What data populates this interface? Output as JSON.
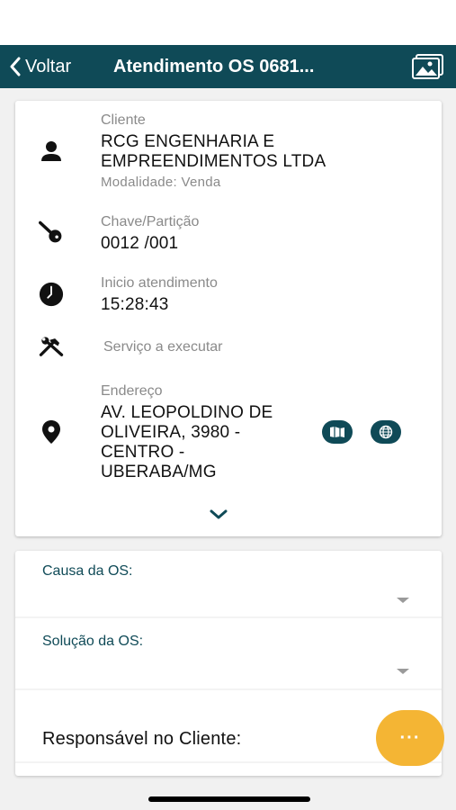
{
  "header": {
    "back_label": "Voltar",
    "title": "Atendimento OS 0681...",
    "gallery_icon": "gallery-icon",
    "bar_color": "#0f4a57"
  },
  "details": {
    "cliente": {
      "label": "Cliente",
      "name_line1": "RCG ENGENHARIA E",
      "name_line2": "EMPREENDIMENTOS LTDA",
      "modalidade": "Modalidade: Venda",
      "icon": "person-icon"
    },
    "chave": {
      "label": "Chave/Partição",
      "value": "0012 /001",
      "icon": "key-icon"
    },
    "inicio": {
      "label": "Inicio atendimento",
      "value": "15:28:43",
      "icon": "clock-icon"
    },
    "servico": {
      "label": "Serviço a executar",
      "icon": "tools-icon"
    },
    "endereco": {
      "label": "Endereço",
      "line1": "AV. LEOPOLDINO DE",
      "line2": "OLIVEIRA, 3980 -",
      "line3": "CENTRO -",
      "line4": "UBERABA/MG",
      "icon": "location-pin-icon",
      "map_button_icon": "map-icon",
      "globe_button_icon": "globe-icon"
    },
    "expand_icon": "chevron-down-icon"
  },
  "form": {
    "causa_label": "Causa da OS:",
    "causa_value": "",
    "solucao_label": "Solução da OS:",
    "solucao_value": "",
    "responsavel_label": "Responsável no Cliente:"
  },
  "fab": {
    "label": "···",
    "color": "#f4b534"
  }
}
